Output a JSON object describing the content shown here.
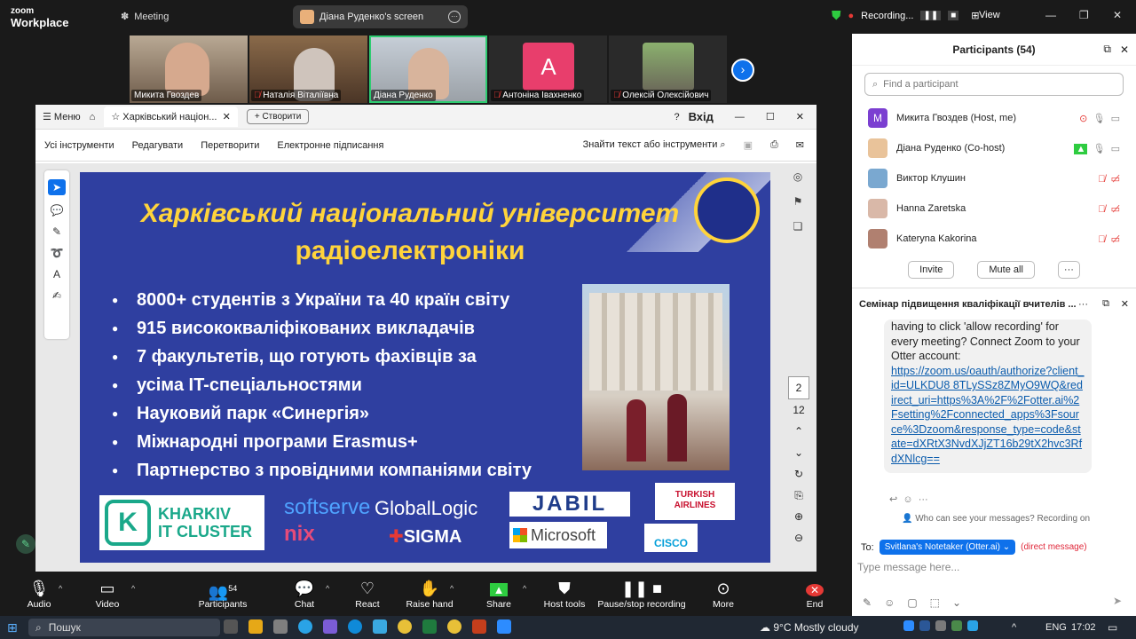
{
  "app": {
    "brand_line1": "zoom",
    "brand_line2": "Workplace",
    "meeting_label": "Meeting",
    "screen_share_label": "Діана Руденко's screen",
    "recording_label": "Recording...",
    "view_label": "View"
  },
  "thumbs": [
    {
      "name": "Микита Гвоздев"
    },
    {
      "name": "Наталія Віталіївна"
    },
    {
      "name": "Діана Руденко"
    },
    {
      "name": "Антоніна Івахненко",
      "initial": "A"
    },
    {
      "name": "Олексій Олексійович"
    }
  ],
  "pdf": {
    "menu_label": "Меню",
    "tab_title": "Харківський націон...",
    "create_label": "+ Створити",
    "login_label": "Вхід",
    "toolbar": [
      "Усі інструменти",
      "Редагувати",
      "Перетворити",
      "Електронне підписання"
    ],
    "find_label": "Знайти текст або інструменти",
    "page_current": "2",
    "page_total": "12"
  },
  "slide": {
    "title1": "Харківський національний університет",
    "title2": "радіоелектроніки",
    "bullets": [
      "8000+ студентів з України та 40 країн світу",
      "915 висококваліфікованих викладачів",
      "7 факультетів, що готують фахівців за",
      "усіма IT-спеціальностями",
      "Науковий парк «Синергія»",
      "Міжнародні програми Erasmus+",
      "Партнерство з провідними компаніями світу"
    ],
    "logos": {
      "kharkiv1": "KHARKIV",
      "kharkiv2": "IT CLUSTER",
      "softserve": "softserve",
      "nix": "nix",
      "globallogic": "GlobalLogic",
      "sigma": "SIGMA",
      "jabil": "JABIL",
      "microsoft": "Microsoft",
      "turkish1": "TURKISH",
      "turkish2": "AIRLINES",
      "cisco": "CISCO"
    }
  },
  "participants": {
    "header": "Participants (54)",
    "search_placeholder": "Find a participant",
    "list": [
      {
        "name": "Микита Гвоздев (Host, me)",
        "initial": "M"
      },
      {
        "name": "Діана Руденко (Co-host)"
      },
      {
        "name": "Виктор Клушин"
      },
      {
        "name": "Hanna Zaretska"
      },
      {
        "name": "Kateryna Kakorina"
      }
    ],
    "invite_label": "Invite",
    "mute_all_label": "Mute all",
    "more_label": "···"
  },
  "chat": {
    "header": "Семінар підвищення кваліфікації вчителів ...",
    "message_text": "having to click 'allow recording' for every meeting? Connect Zoom to your Otter account:",
    "message_link": "https://zoom.us/oauth/authorize?client_id=ULKDU8 8TLySSz8ZMyO9WQ&redirect_uri=https%3A%2F%2Fotter.ai%2Fsetting%2Fconnected_apps%3Fsource%3Dzoom&response_type=code&state=dXRtX3NvdXJjZT16b29tX2hvc3RfdXNlcg==",
    "who_can_see": "Who can see your messages? Recording on",
    "to_label": "To:",
    "to_recipient": "Svitlana's Notetaker (Otter.ai)",
    "direct_message": "(direct message)",
    "input_placeholder": "Type message here..."
  },
  "bottom": {
    "audio": "Audio",
    "video": "Video",
    "participants": "Participants",
    "participants_count": "54",
    "chat": "Chat",
    "react": "React",
    "raise_hand": "Raise hand",
    "share": "Share",
    "host_tools": "Host tools",
    "pause_stop": "Pause/stop recording",
    "more": "More",
    "end": "End"
  },
  "taskbar": {
    "search": "Пошук",
    "weather": "9°C  Mostly cloudy",
    "lang": "ENG",
    "time": "17:02"
  }
}
